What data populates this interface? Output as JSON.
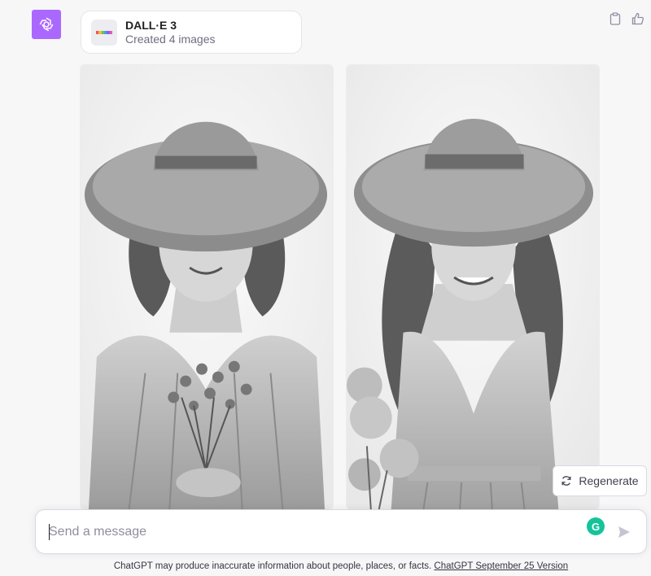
{
  "tool_card": {
    "title": "DALL·E 3",
    "subtitle": "Created 4 images",
    "rainbow": [
      "#e85b5b",
      "#f4b83a",
      "#6cc24a",
      "#3aa3e8",
      "#8a5cf0",
      "#e85bb3"
    ]
  },
  "avatar": {
    "icon": "openai-logo-icon",
    "bg": "#ab68ff"
  },
  "actions": {
    "copy_icon": "clipboard-icon",
    "like_icon": "thumbs-up-icon"
  },
  "images": [
    {
      "subject": "woman-sun-hat-eyes-closed-bouquet"
    },
    {
      "subject": "young-woman-sun-hat-smiling-flowers"
    }
  ],
  "regenerate": {
    "label": "Regenerate",
    "icon": "refresh-icon"
  },
  "composer": {
    "placeholder": "Send a message",
    "send_icon": "send-icon",
    "grammarly_icon": "grammarly-icon",
    "grammarly_letter": "G"
  },
  "footer": {
    "text": "ChatGPT may produce inaccurate information about people, places, or facts. ",
    "link": "ChatGPT September 25 Version"
  }
}
